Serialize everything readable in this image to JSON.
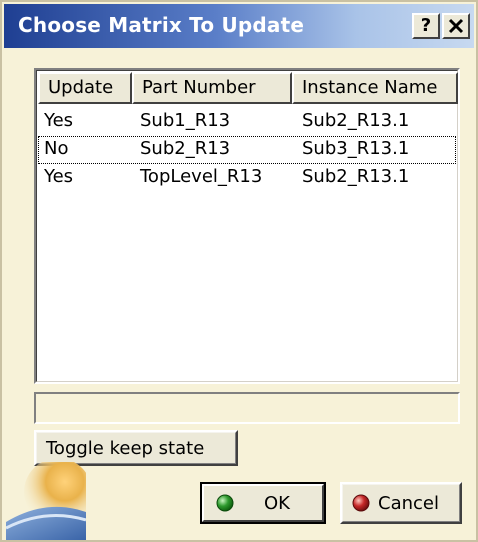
{
  "window": {
    "title": "Choose Matrix To Update",
    "help_button": "?",
    "close_button": "✕"
  },
  "table": {
    "columns": [
      "Update",
      "Part Number",
      "Instance Name"
    ],
    "rows": [
      {
        "update": "Yes",
        "part_number": "Sub1_R13",
        "instance_name": "Sub2_R13.1"
      },
      {
        "update": "No",
        "part_number": "Sub2_R13",
        "instance_name": "Sub3_R13.1"
      },
      {
        "update": "Yes",
        "part_number": "TopLevel_R13",
        "instance_name": "Sub2_R13.1"
      }
    ]
  },
  "status_text": "",
  "buttons": {
    "toggle_label": "Toggle keep state",
    "ok_label": "OK",
    "cancel_label": "Cancel"
  },
  "colors": {
    "title_gradient_start": "#1f3f92",
    "dialog_background": "#f7f2d8",
    "ok_icon": "#2e9a2e",
    "cancel_icon": "#c62828"
  },
  "icons": {
    "ok": "green-ball-icon",
    "cancel": "red-ball-icon",
    "logo": "catia-logo-swoosh"
  }
}
